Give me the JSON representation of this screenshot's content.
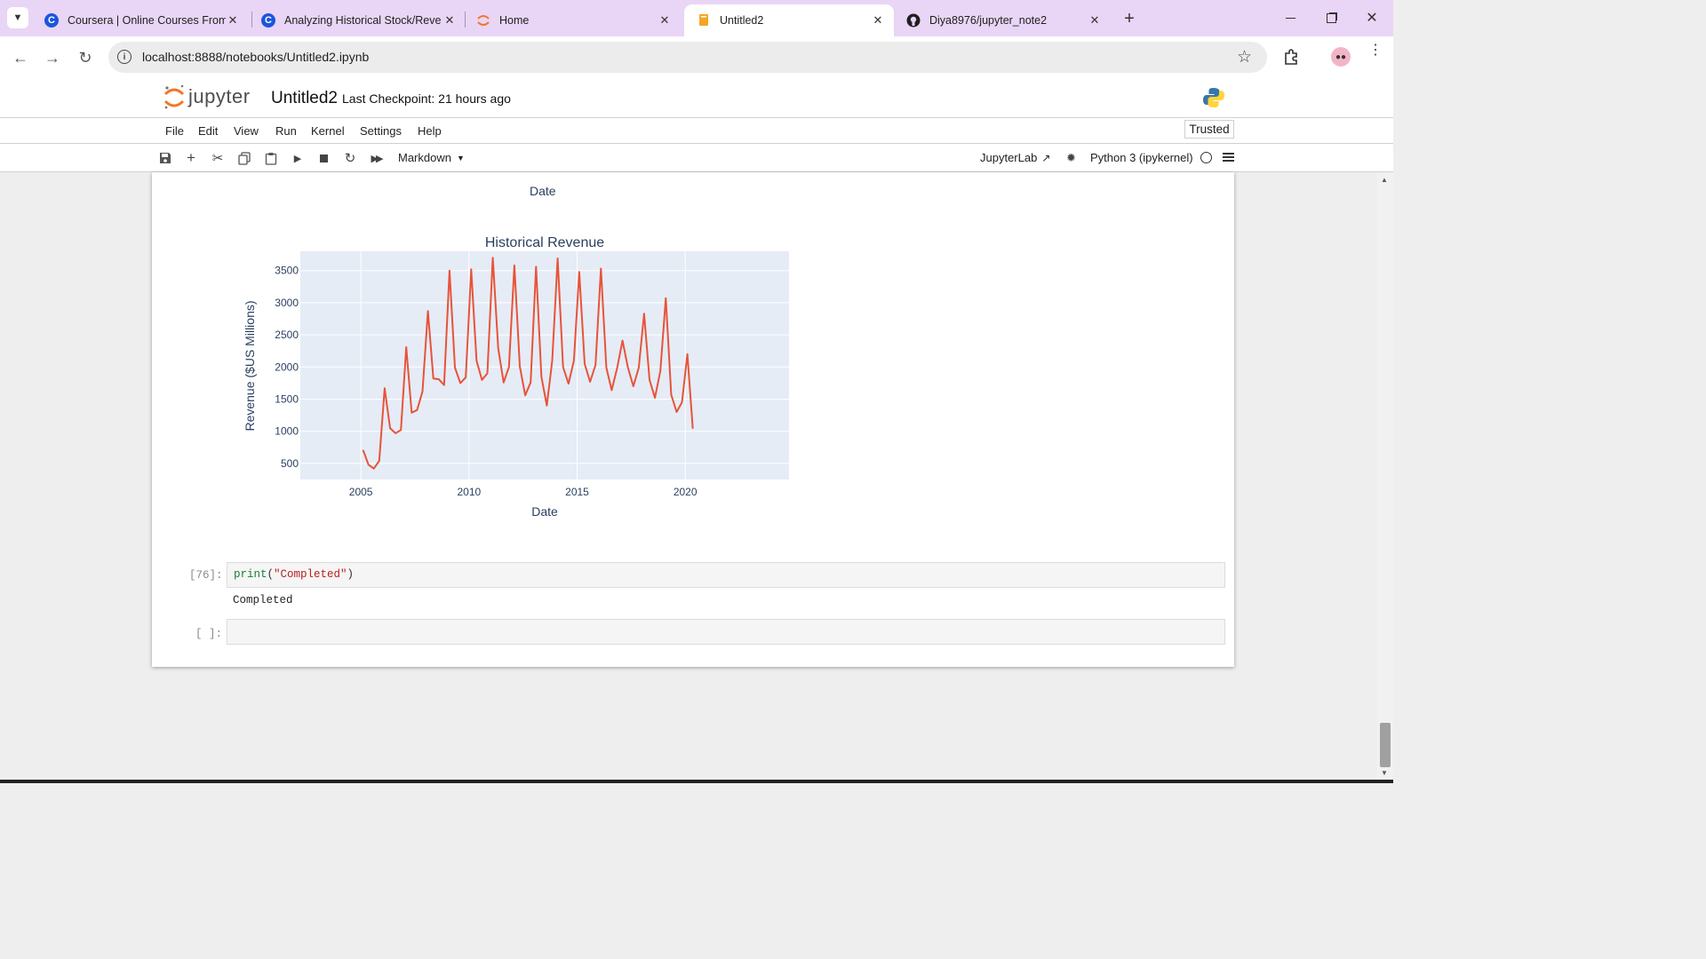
{
  "browser": {
    "tabs": [
      {
        "title": "Coursera | Online Courses From",
        "icon": "coursera-icon"
      },
      {
        "title": "Analyzing Historical Stock/Reve",
        "icon": "coursera-icon"
      },
      {
        "title": "Home",
        "icon": "jupyter-icon"
      },
      {
        "title": "Untitled2",
        "icon": "notebook-icon"
      },
      {
        "title": "Diya8976/jupyter_note2",
        "icon": "github-icon"
      }
    ],
    "active_tab_index": 3,
    "url": "localhost:8888/notebooks/Untitled2.ipynb"
  },
  "jupyter": {
    "logo_text": "jupyter",
    "notebook_name": "Untitled2",
    "checkpoint": "Last Checkpoint: 21 hours ago",
    "trusted": "Trusted",
    "menu": [
      "File",
      "Edit",
      "View",
      "Run",
      "Kernel",
      "Settings",
      "Help"
    ],
    "cell_type": "Markdown",
    "jupyterlab_label": "JupyterLab",
    "kernel_name": "Python 3 (ipykernel)"
  },
  "output_top": {
    "axis_label": "Date"
  },
  "chart_data": {
    "type": "line",
    "title": "Historical Revenue",
    "xlabel": "Date",
    "ylabel": "Revenue ($US Millions)",
    "xlim": [
      2002.2,
      2024.8
    ],
    "ylim": [
      250,
      3800
    ],
    "x_ticks": [
      2005,
      2010,
      2015,
      2020
    ],
    "y_ticks": [
      500,
      1000,
      1500,
      2000,
      2500,
      3000,
      3500
    ],
    "grid": true,
    "color": "#e8533a",
    "background": "#e5ecf6",
    "series": [
      {
        "x": [
          2005.1,
          2005.35,
          2005.6,
          2005.85,
          2006.1,
          2006.35,
          2006.6,
          2006.85,
          2007.1,
          2007.35,
          2007.6,
          2007.85,
          2008.1,
          2008.35,
          2008.6,
          2008.85,
          2009.1,
          2009.35,
          2009.6,
          2009.85,
          2010.1,
          2010.35,
          2010.6,
          2010.85,
          2011.1,
          2011.35,
          2011.6,
          2011.85,
          2012.1,
          2012.35,
          2012.6,
          2012.85,
          2013.1,
          2013.35,
          2013.6,
          2013.85,
          2014.1,
          2014.35,
          2014.6,
          2014.85,
          2015.1,
          2015.35,
          2015.6,
          2015.85,
          2016.1,
          2016.35,
          2016.6,
          2016.85,
          2017.1,
          2017.35,
          2017.6,
          2017.85,
          2018.1,
          2018.35,
          2018.6,
          2018.85,
          2019.1,
          2019.35,
          2019.6,
          2019.85,
          2020.1,
          2020.35
        ],
        "y": [
          710,
          480,
          420,
          540,
          1670,
          1050,
          970,
          1020,
          2310,
          1290,
          1330,
          1620,
          2870,
          1820,
          1810,
          1720,
          3500,
          1990,
          1750,
          1840,
          3520,
          2100,
          1800,
          1900,
          3700,
          2290,
          1760,
          2000,
          3580,
          2010,
          1560,
          1760,
          3560,
          1850,
          1400,
          2100,
          3690,
          2000,
          1740,
          2100,
          3480,
          2050,
          1770,
          2030,
          3530,
          1990,
          1640,
          1980,
          2410,
          1990,
          1700,
          1990,
          2830,
          1800,
          1520,
          1940,
          3070,
          1570,
          1300,
          1450,
          2200,
          1040
        ]
      }
    ]
  },
  "cells": [
    {
      "prompt": "[76]:",
      "code_fn": "print",
      "code_open": "(",
      "code_str": "\"Completed\"",
      "code_close": ")",
      "output": "Completed"
    },
    {
      "prompt": "[ ]:",
      "code": ""
    }
  ]
}
